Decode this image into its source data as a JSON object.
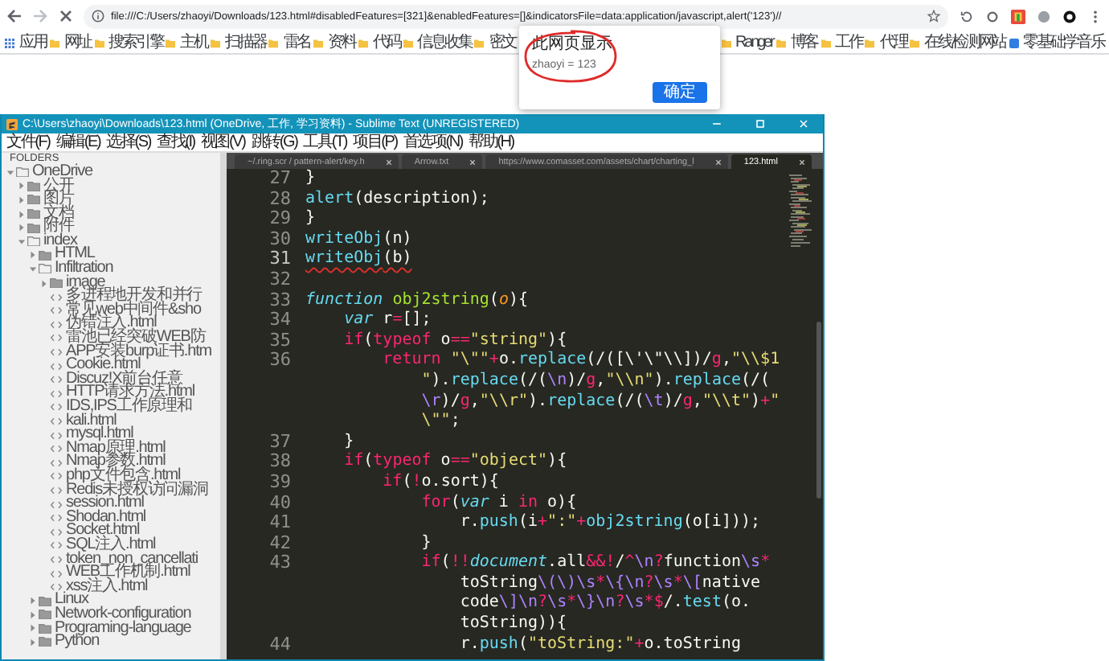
{
  "browser": {
    "url": "file:///C:/Users/zhaoyi/Downloads/123.html#disabledFeatures=[321]&enabledFeatures=[]&indicatorsFile=data:application/javascript,alert('123')//",
    "bookmarks_left": [
      {
        "label": "应用",
        "kind": "apps"
      },
      {
        "label": "网址",
        "kind": "folder"
      },
      {
        "label": "搜索引擎",
        "kind": "folder"
      },
      {
        "label": "主机",
        "kind": "folder"
      },
      {
        "label": "扫描器",
        "kind": "folder"
      },
      {
        "label": "雷名",
        "kind": "folder"
      },
      {
        "label": "资料",
        "kind": "folder"
      },
      {
        "label": "代码",
        "kind": "folder"
      },
      {
        "label": "信息收集",
        "kind": "folder"
      },
      {
        "label": "密文",
        "kind": "folder"
      }
    ],
    "bookmarks_right": [
      {
        "label": "Ranger",
        "kind": "folder"
      },
      {
        "label": "博客",
        "kind": "folder"
      },
      {
        "label": "工作",
        "kind": "folder"
      },
      {
        "label": "代理",
        "kind": "folder"
      },
      {
        "label": "在线检测网站",
        "kind": "folder"
      },
      {
        "label": "零基础学音乐",
        "kind": "site"
      }
    ]
  },
  "alert_dialog": {
    "title": "此网页显示",
    "message": "zhaoyi = 123",
    "button": "确定",
    "circled": true
  },
  "editor": {
    "title": "C:\\Users\\zhaoyi\\Downloads\\123.html (OneDrive, 工作, 学习资料) - Sublime Text (UNREGISTERED)",
    "menu": [
      "文件(F)",
      "编辑(E)",
      "选择(S)",
      "查找(I)",
      "视图(V)",
      "跳转(G)",
      "工具(T)",
      "项目(P)",
      "首选项(N)",
      "帮助(H)"
    ],
    "folders_header": "FOLDERS",
    "tree": [
      {
        "label": "OneDrive",
        "kind": "folder",
        "expanded": true,
        "children": [
          {
            "label": "公开",
            "kind": "folder",
            "expanded": false
          },
          {
            "label": "图片",
            "kind": "folder",
            "expanded": false
          },
          {
            "label": "文档",
            "kind": "folder",
            "expanded": false
          },
          {
            "label": "附件",
            "kind": "folder",
            "expanded": false
          },
          {
            "label": "index",
            "kind": "folder",
            "expanded": true,
            "children": [
              {
                "label": "HTML",
                "kind": "folder",
                "expanded": false
              },
              {
                "label": "Infiltration",
                "kind": "folder",
                "expanded": true,
                "children": [
                  {
                    "label": "image",
                    "kind": "folder",
                    "expanded": false
                  },
                  {
                    "label": "多进程地开发和并行",
                    "kind": "file"
                  },
                  {
                    "label": "常见web中间件&sho",
                    "kind": "file"
                  },
                  {
                    "label": "伪错注入.html",
                    "kind": "file"
                  },
                  {
                    "label": "雷池已经突破WEB防",
                    "kind": "file"
                  },
                  {
                    "label": "APP安装burp证书.htm",
                    "kind": "file"
                  },
                  {
                    "label": "Cookie.html",
                    "kind": "file"
                  },
                  {
                    "label": "Discuz!X前台任意",
                    "kind": "file"
                  },
                  {
                    "label": "HTTP请求方法.html",
                    "kind": "file"
                  },
                  {
                    "label": "IDS,IPS工作原理和",
                    "kind": "file"
                  },
                  {
                    "label": "kali.html",
                    "kind": "file"
                  },
                  {
                    "label": "mysql.html",
                    "kind": "file"
                  },
                  {
                    "label": "Nmap原理.html",
                    "kind": "file"
                  },
                  {
                    "label": "Nmap参数.html",
                    "kind": "file"
                  },
                  {
                    "label": "php文件包含.html",
                    "kind": "file"
                  },
                  {
                    "label": "Redis未授权访问漏洞",
                    "kind": "file"
                  },
                  {
                    "label": "session.html",
                    "kind": "file"
                  },
                  {
                    "label": "Shodan.html",
                    "kind": "file"
                  },
                  {
                    "label": "Socket.html",
                    "kind": "file"
                  },
                  {
                    "label": "SQL注入.html",
                    "kind": "file"
                  },
                  {
                    "label": "token_non_cancellati",
                    "kind": "file"
                  },
                  {
                    "label": "WEB工作机制.html",
                    "kind": "file"
                  },
                  {
                    "label": "xss注入.html",
                    "kind": "file"
                  }
                ]
              },
              {
                "label": "Linux",
                "kind": "folder",
                "expanded": false
              },
              {
                "label": "Network-configuration",
                "kind": "folder",
                "expanded": false
              },
              {
                "label": "Programing-language",
                "kind": "folder",
                "expanded": false
              },
              {
                "label": "Python",
                "kind": "folder",
                "expanded": false
              }
            ]
          }
        ]
      }
    ],
    "tabs": [
      {
        "label": "~/.ring.scr / pattern-alert/key.h",
        "selected": false
      },
      {
        "label": "Arrow.txt",
        "selected": false
      },
      {
        "label": "https://www.comasset.com/assets/chart/charting_l",
        "selected": false
      },
      {
        "label": "123.html",
        "selected": true
      }
    ],
    "lines": [
      {
        "number": "27",
        "underlined": false,
        "rows": [
          {
            "segments": [
              {
                "text": "}",
                "kind": "plain"
              }
            ]
          }
        ]
      },
      {
        "number": "28",
        "underlined": false,
        "rows": [
          {
            "segments": [
              {
                "text": "alert",
                "kind": "support"
              },
              {
                "text": "(description);",
                "kind": "plain"
              }
            ]
          }
        ]
      },
      {
        "number": "29",
        "underlined": false,
        "rows": [
          {
            "segments": [
              {
                "text": "}",
                "kind": "plain"
              }
            ]
          }
        ]
      },
      {
        "number": "30",
        "underlined": false,
        "rows": [
          {
            "segments": [
              {
                "text": "writeObj",
                "kind": "support"
              },
              {
                "text": "(n)",
                "kind": "plain"
              }
            ]
          }
        ]
      },
      {
        "number": "31",
        "underlined": true,
        "rows": [
          {
            "segments": [
              {
                "text": "writeObj",
                "kind": "support"
              },
              {
                "text": "(b)",
                "kind": "plain"
              }
            ]
          }
        ]
      },
      {
        "number": "32",
        "underlined": false
      },
      {
        "number": "33",
        "underlined": false,
        "rows": [
          {
            "segments": [
              {
                "text": "function ",
                "kind": "storage"
              },
              {
                "text": "obj2string",
                "kind": "function"
              },
              {
                "text": "(",
                "kind": "plain"
              },
              {
                "text": "o",
                "kind": "param"
              },
              {
                "text": "){",
                "kind": "plain"
              }
            ]
          }
        ]
      },
      {
        "number": "34",
        "underlined": false,
        "rows": [
          {
            "segments": [
              {
                "text": "    var",
                "kind": "storage"
              },
              {
                "text": " r",
                "kind": "plain"
              },
              {
                "text": "=",
                "kind": "keyword"
              },
              {
                "text": "[];",
                "kind": "plain"
              }
            ]
          }
        ]
      },
      {
        "number": "35",
        "underlined": false,
        "rows": [
          {
            "segments": [
              {
                "text": "    if",
                "kind": "keyword"
              },
              {
                "text": "(",
                "kind": "plain"
              },
              {
                "text": "typeof",
                "kind": "keyword"
              },
              {
                "text": " o",
                "kind": "plain"
              },
              {
                "text": "==",
                "kind": "keyword"
              },
              {
                "text": "\"string\"",
                "kind": "string"
              },
              {
                "text": "){",
                "kind": "plain"
              }
            ]
          }
        ]
      },
      {
        "number": "36",
        "underlined": false,
        "rows": [
          {
            "segments": [
              {
                "text": "        return ",
                "kind": "keyword"
              },
              {
                "text": "\"\\\"\"",
                "kind": "string"
              },
              {
                "text": "+",
                "kind": "keyword"
              },
              {
                "text": "o.",
                "kind": "plain"
              },
              {
                "text": "replace",
                "kind": "support"
              },
              {
                "text": "(/([\\'\\\"\\\\])/",
                "kind": "plain"
              },
              {
                "text": "g",
                "kind": "keyword"
              },
              {
                "text": ",",
                "kind": "plain"
              },
              {
                "text": "\"\\\\$1",
                "kind": "string"
              }
            ]
          },
          {
            "segments": [
              {
                "text": "            \"",
                "kind": "string"
              },
              {
                "text": ").",
                "kind": "plain"
              },
              {
                "text": "replace",
                "kind": "support"
              },
              {
                "text": "(/(",
                "kind": "plain"
              },
              {
                "text": "\\n",
                "kind": "escape"
              },
              {
                "text": ")/",
                "kind": "plain"
              },
              {
                "text": "g",
                "kind": "keyword"
              },
              {
                "text": ",",
                "kind": "plain"
              },
              {
                "text": "\"\\\\n\"",
                "kind": "string"
              },
              {
                "text": ").",
                "kind": "plain"
              },
              {
                "text": "replace",
                "kind": "support"
              },
              {
                "text": "(/(",
                "kind": "plain"
              }
            ]
          },
          {
            "segments": [
              {
                "text": "            \\r",
                "kind": "escape"
              },
              {
                "text": ")/",
                "kind": "plain"
              },
              {
                "text": "g",
                "kind": "keyword"
              },
              {
                "text": ",",
                "kind": "plain"
              },
              {
                "text": "\"\\\\r\"",
                "kind": "string"
              },
              {
                "text": ").",
                "kind": "plain"
              },
              {
                "text": "replace",
                "kind": "support"
              },
              {
                "text": "(/(",
                "kind": "plain"
              },
              {
                "text": "\\t",
                "kind": "escape"
              },
              {
                "text": ")/",
                "kind": "plain"
              },
              {
                "text": "g",
                "kind": "keyword"
              },
              {
                "text": ",",
                "kind": "plain"
              },
              {
                "text": "\"\\\\t\"",
                "kind": "string"
              },
              {
                "text": ")",
                "kind": "plain"
              },
              {
                "text": "+",
                "kind": "keyword"
              },
              {
                "text": "\"",
                "kind": "string"
              }
            ]
          },
          {
            "segments": [
              {
                "text": "            \\\"\"",
                "kind": "string"
              },
              {
                "text": ";",
                "kind": "plain"
              }
            ]
          }
        ]
      },
      {
        "number": "37",
        "underlined": false,
        "rows": [
          {
            "segments": [
              {
                "text": "    }",
                "kind": "plain"
              }
            ]
          }
        ]
      },
      {
        "number": "38",
        "underlined": false,
        "rows": [
          {
            "segments": [
              {
                "text": "    if",
                "kind": "keyword"
              },
              {
                "text": "(",
                "kind": "plain"
              },
              {
                "text": "typeof",
                "kind": "keyword"
              },
              {
                "text": " o",
                "kind": "plain"
              },
              {
                "text": "==",
                "kind": "keyword"
              },
              {
                "text": "\"object\"",
                "kind": "string"
              },
              {
                "text": "){",
                "kind": "plain"
              }
            ]
          }
        ]
      },
      {
        "number": "39",
        "underlined": false,
        "rows": [
          {
            "segments": [
              {
                "text": "        if",
                "kind": "keyword"
              },
              {
                "text": "(",
                "kind": "plain"
              },
              {
                "text": "!",
                "kind": "keyword"
              },
              {
                "text": "o.sort){",
                "kind": "plain"
              }
            ]
          }
        ]
      },
      {
        "number": "40",
        "underlined": false,
        "rows": [
          {
            "segments": [
              {
                "text": "            for",
                "kind": "keyword"
              },
              {
                "text": "(",
                "kind": "plain"
              },
              {
                "text": "var",
                "kind": "storage"
              },
              {
                "text": " i ",
                "kind": "plain"
              },
              {
                "text": "in",
                "kind": "keyword"
              },
              {
                "text": " o){",
                "kind": "plain"
              }
            ]
          }
        ]
      },
      {
        "number": "41",
        "underlined": false,
        "rows": [
          {
            "segments": [
              {
                "text": "                r.",
                "kind": "plain"
              },
              {
                "text": "push",
                "kind": "support"
              },
              {
                "text": "(i",
                "kind": "plain"
              },
              {
                "text": "+",
                "kind": "keyword"
              },
              {
                "text": "\":\"",
                "kind": "string"
              },
              {
                "text": "+",
                "kind": "keyword"
              },
              {
                "text": "obj2string",
                "kind": "support"
              },
              {
                "text": "(o[i]));",
                "kind": "plain"
              }
            ]
          }
        ]
      },
      {
        "number": "42",
        "underlined": false,
        "rows": [
          {
            "segments": [
              {
                "text": "            }",
                "kind": "plain"
              }
            ]
          }
        ]
      },
      {
        "number": "43",
        "underlined": false,
        "rows": [
          {
            "segments": [
              {
                "text": "            if",
                "kind": "keyword"
              },
              {
                "text": "(",
                "kind": "plain"
              },
              {
                "text": "!!",
                "kind": "keyword"
              },
              {
                "text": "document",
                "kind": "storage"
              },
              {
                "text": ".all",
                "kind": "plain"
              },
              {
                "text": "&&!",
                "kind": "keyword"
              },
              {
                "text": "/",
                "kind": "plain"
              },
              {
                "text": "^",
                "kind": "keyword"
              },
              {
                "text": "\\n",
                "kind": "escape"
              },
              {
                "text": "?",
                "kind": "keyword"
              },
              {
                "text": "function",
                "kind": "plain"
              },
              {
                "text": "\\s",
                "kind": "escape"
              },
              {
                "text": "*",
                "kind": "keyword"
              }
            ]
          },
          {
            "segments": [
              {
                "text": "                toString",
                "kind": "plain"
              },
              {
                "text": "\\(\\)\\s",
                "kind": "escape"
              },
              {
                "text": "*",
                "kind": "keyword"
              },
              {
                "text": "\\{\\n",
                "kind": "escape"
              },
              {
                "text": "?",
                "kind": "keyword"
              },
              {
                "text": "\\s",
                "kind": "escape"
              },
              {
                "text": "*",
                "kind": "keyword"
              },
              {
                "text": "\\[",
                "kind": "escape"
              },
              {
                "text": "native",
                "kind": "plain"
              }
            ]
          },
          {
            "segments": [
              {
                "text": "                code",
                "kind": "plain"
              },
              {
                "text": "\\]\\n",
                "kind": "escape"
              },
              {
                "text": "?",
                "kind": "keyword"
              },
              {
                "text": "\\s",
                "kind": "escape"
              },
              {
                "text": "*",
                "kind": "keyword"
              },
              {
                "text": "\\}\\n",
                "kind": "escape"
              },
              {
                "text": "?",
                "kind": "keyword"
              },
              {
                "text": "\\s",
                "kind": "escape"
              },
              {
                "text": "*$",
                "kind": "keyword"
              },
              {
                "text": "/.",
                "kind": "plain"
              },
              {
                "text": "test",
                "kind": "support"
              },
              {
                "text": "(o.",
                "kind": "plain"
              }
            ]
          },
          {
            "segments": [
              {
                "text": "                toString)){",
                "kind": "plain"
              }
            ]
          }
        ]
      },
      {
        "number": "44",
        "underlined": false,
        "rows": [
          {
            "segments": [
              {
                "text": "                r.",
                "kind": "plain"
              },
              {
                "text": "push",
                "kind": "support"
              },
              {
                "text": "(",
                "kind": "plain"
              },
              {
                "text": "\"toString:\"",
                "kind": "string"
              },
              {
                "text": "+",
                "kind": "keyword"
              },
              {
                "text": "o.toString",
                "kind": "plain"
              }
            ]
          }
        ]
      }
    ]
  }
}
